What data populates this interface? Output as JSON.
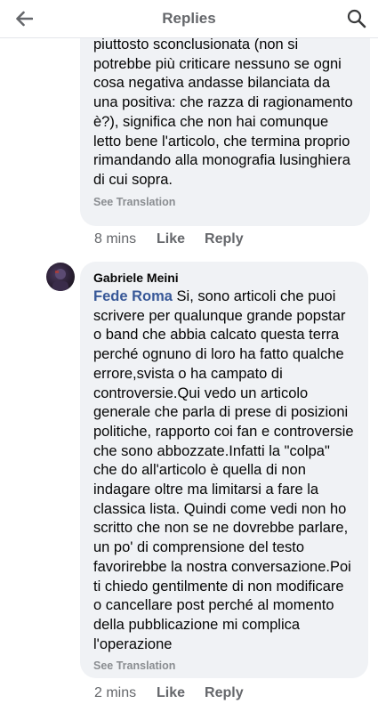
{
  "header": {
    "title": "Replies",
    "back_icon": "arrow-left-icon",
    "search_icon": "search-icon"
  },
  "comments": [
    {
      "text": "piuttosto sconclusionata (non si potrebbe più criticare nessuno se ogni cosa negativa andasse bilanciata da una positiva: che razza di ragionamento è?), significa che non hai comunque letto bene l'articolo, che termina proprio rimandando alla monografia lusinghiera di cui sopra.",
      "see_translation": "See Translation",
      "time": "8 mins",
      "like": "Like",
      "reply": "Reply"
    },
    {
      "author": "Gabriele Meini",
      "mention": "Fede Roma",
      "text": "Si, sono articoli che puoi scrivere per qualunque grande popstar o band che abbia calcato questa terra perché ognuno di loro ha fatto qualche errore,svista o ha campato di controversie.Qui vedo un articolo generale che parla di prese di posizioni politiche, rapporto coi fan e controversie che sono abbozzate.Infatti la \"colpa\" che do all'articolo è quella di non indagare oltre ma limitarsi a fare la classica lista. Quindi come vedi non ho scritto che non se ne dovrebbe parlare, un po' di comprensione del testo favorirebbe la nostra conversazione.Poi ti chiedo gentilmente di non modificare o cancellare post perché al momento della pubblicazione mi complica l'operazione",
      "see_translation": "See Translation",
      "time": "2 mins",
      "like": "Like",
      "reply": "Reply"
    }
  ],
  "colors": {
    "bubble": "#f0f2f5",
    "mention": "#385898",
    "meta": "#65676b"
  }
}
